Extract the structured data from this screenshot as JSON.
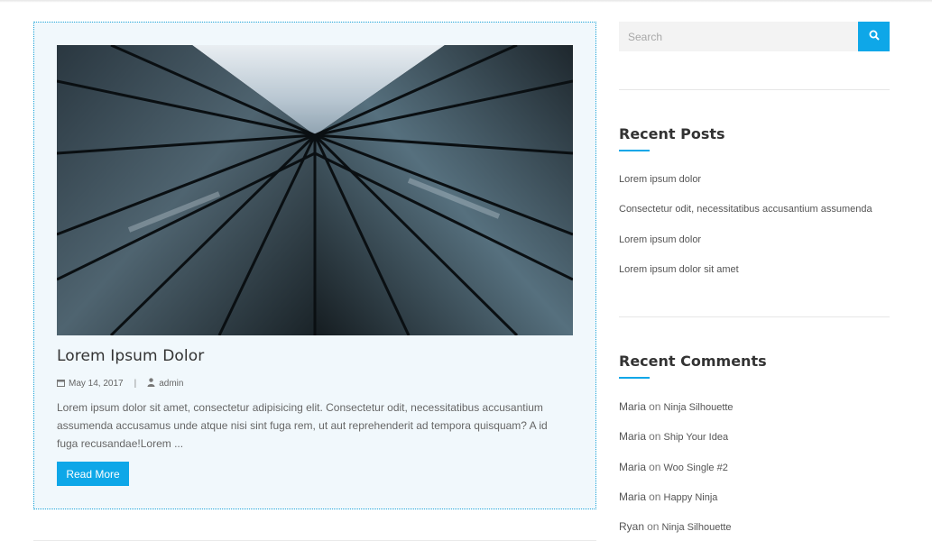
{
  "post": {
    "title": "Lorem Ipsum Dolor",
    "date": "May 14, 2017",
    "meta_separator": "|",
    "author": "admin",
    "excerpt": "Lorem ipsum dolor sit amet, consectetur adipisicing elit. Consectetur odit, necessitatibus accusantium assumenda accusamus unde atque nisi sint fuga rem, ut aut reprehenderit ad tempora quisquam? A id fuga recusandae!Lorem ...",
    "read_more_label": "Read More",
    "image_icon": "building-glass-photo"
  },
  "search": {
    "placeholder": "Search",
    "button_icon": "search-icon"
  },
  "recent_posts": {
    "title": "Recent Posts",
    "items": [
      "Lorem ipsum dolor",
      "Consectetur odit, necessitatibus accusantium assumenda",
      "Lorem ipsum dolor",
      "Lorem ipsum dolor sit amet"
    ]
  },
  "recent_comments": {
    "title": "Recent Comments",
    "on_word": "on",
    "items": [
      {
        "author": "Maria",
        "post": "Ninja Silhouette"
      },
      {
        "author": "Maria",
        "post": "Ship Your Idea"
      },
      {
        "author": "Maria",
        "post": "Woo Single #2"
      },
      {
        "author": "Maria",
        "post": "Happy Ninja"
      },
      {
        "author": "Ryan",
        "post": "Ninja Silhouette"
      }
    ]
  },
  "colors": {
    "accent": "#0ea7e8",
    "card_background": "#f1f8fc",
    "card_border": "#1ea5d9"
  }
}
